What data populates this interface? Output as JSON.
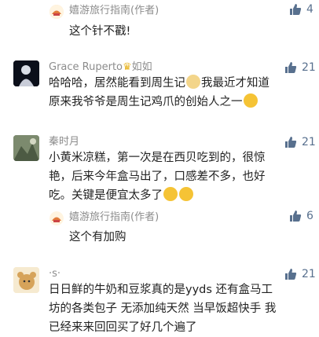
{
  "comments": [
    {
      "author": "嬉游旅行指南(作者)",
      "text": "这个针不戳!",
      "likes": "4"
    },
    {
      "author": "Grace Ruperto",
      "badge": "如如",
      "text_line1": "哈哈哈，居然能看到周生记",
      "text_line1b": "我最近才知道",
      "text_line2": "原来我爷爷是周生记鸡爪的创始人之一",
      "likes": "21"
    },
    {
      "author": "秦时月",
      "text_line1": "小黄米凉糕，第一次是在西贝吃到的，很惊",
      "text_line2": "艳，后来今年盒马出了，口感差不多，也好",
      "text_line3": "吃。关键是便宜太多了",
      "likes": "21"
    },
    {
      "author": "嬉游旅行指南(作者)",
      "text": "这个有加购",
      "likes": "6"
    },
    {
      "author": "·s·",
      "text_line1": "日日鲜的牛奶和豆浆真的是yyds 还有盒马工",
      "text_line2": "坊的各类包子 无添加纯天然 当早饭超快手 我",
      "text_line3": "已经来来回回买了好几个遍了",
      "likes": "21"
    }
  ],
  "icons": {
    "like": "thumbs-up-icon"
  },
  "colors": {
    "like": "#58708e",
    "name": "#8c8c8c"
  }
}
